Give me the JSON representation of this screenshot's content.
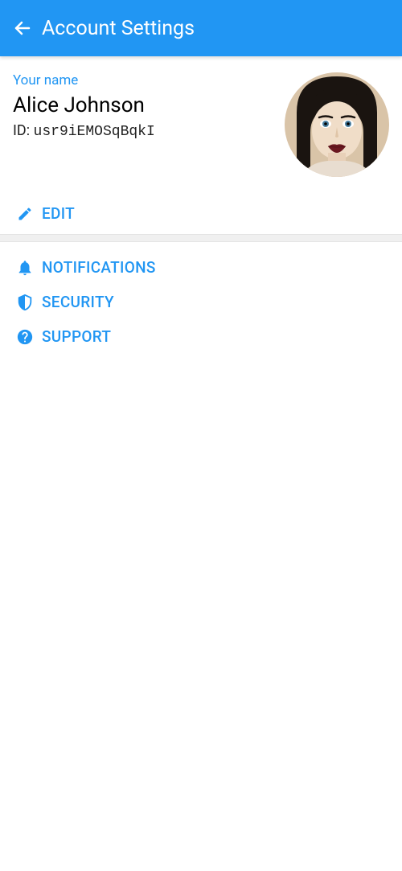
{
  "header": {
    "title": "Account Settings"
  },
  "profile": {
    "name_label": "Your name",
    "name": "Alice Johnson",
    "id_label": "ID: ",
    "id_value": "usr9iEMOSqBqkI"
  },
  "actions": {
    "edit_label": "EDIT"
  },
  "menu": {
    "notifications_label": "NOTIFICATIONS",
    "security_label": "SECURITY",
    "support_label": "SUPPORT"
  }
}
